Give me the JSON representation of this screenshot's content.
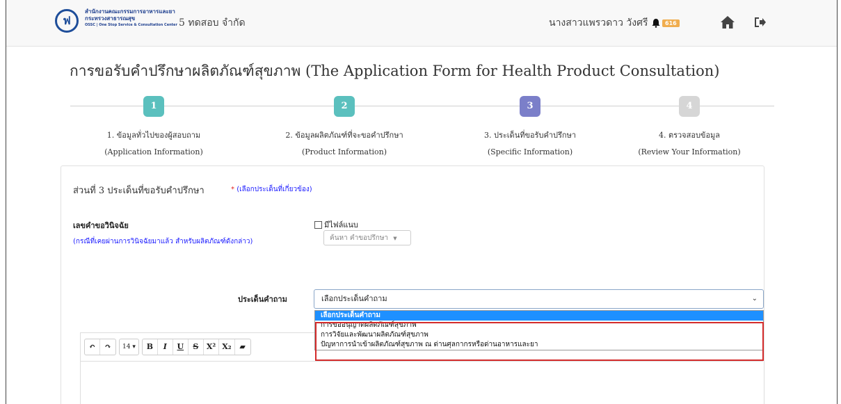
{
  "header": {
    "org_line1": "สำนักงานคณะกรรมการอาหารและยา",
    "org_line2": "กระทรวงสาธารณสุข",
    "org_line3": "OSSC | One Stop Service & Consultation Center",
    "company": "5 ทดสอบ จำกัด",
    "user_name": "นางสาวแพรวดาว วังศรี",
    "notification_count": "616"
  },
  "page": {
    "title": "การขอรับคำปรึกษาผลิตภัณฑ์สุขภาพ (The Application Form for Health Product Consultation)"
  },
  "wizard": {
    "steps": [
      {
        "num": "1",
        "label_th": "1. ข้อมูลทั่วไปของผู้สอบถาม",
        "label_en": "(Application Information)",
        "color": "#5bc0be"
      },
      {
        "num": "2",
        "label_th": "2. ข้อมูลผลิตภัณฑ์ที่จะขอคำปรึกษา",
        "label_en": "(Product Information)",
        "color": "#5bc0be"
      },
      {
        "num": "3",
        "label_th": "3. ประเด็นที่ขอรับคำปรึกษา",
        "label_en": "(Specific Information)",
        "color": "#7b7fc9"
      },
      {
        "num": "4",
        "label_th": "4. ตรวจสอบข้อมูล",
        "label_en": "(Review Your Information)",
        "color": "#d6d6d6"
      }
    ]
  },
  "form": {
    "section_title": "ส่วนที่ 3 ประเด็นที่ขอรับคำปรึกษา",
    "section_hint_star": "*",
    "section_hint": "(เลือกประเด็นที่เกี่ยวข้อง)",
    "ruling_label": "เลขคำขอวินิจฉัย",
    "ruling_hint": "(กรณีที่เคยผ่านการวินิจฉัยมาแล้ว สำหรับผลิตภัณฑ์ดังกล่าว)",
    "attach_label": "มีไฟล์แนบ",
    "search_placeholder": "ค้นหา คำขอปรึกษา",
    "question_label": "ประเด็นคำถาม",
    "question_selected": "เลือกประเด็นคำถาม",
    "question_options": [
      "เลือกประเด็นคำถาม",
      "การขออนุญาตผลิตภัณฑ์สุขภาพ",
      "การวิจัยและพัฒนาผลิตภัณฑ์สุขภาพ",
      "ปัญหาการนำเข้าผลิตภัณฑ์สุขภาพ ณ ด่านศุลกากรหรือด่านอาหารและยา"
    ]
  },
  "editor": {
    "font_size": "14",
    "buttons": [
      "B",
      "I",
      "U",
      "S",
      "X²",
      "X₂"
    ]
  },
  "colors": {
    "accent_blue": "#1e90ff",
    "highlight_red": "#d42b2b",
    "hint_blue": "#1a1aff"
  }
}
